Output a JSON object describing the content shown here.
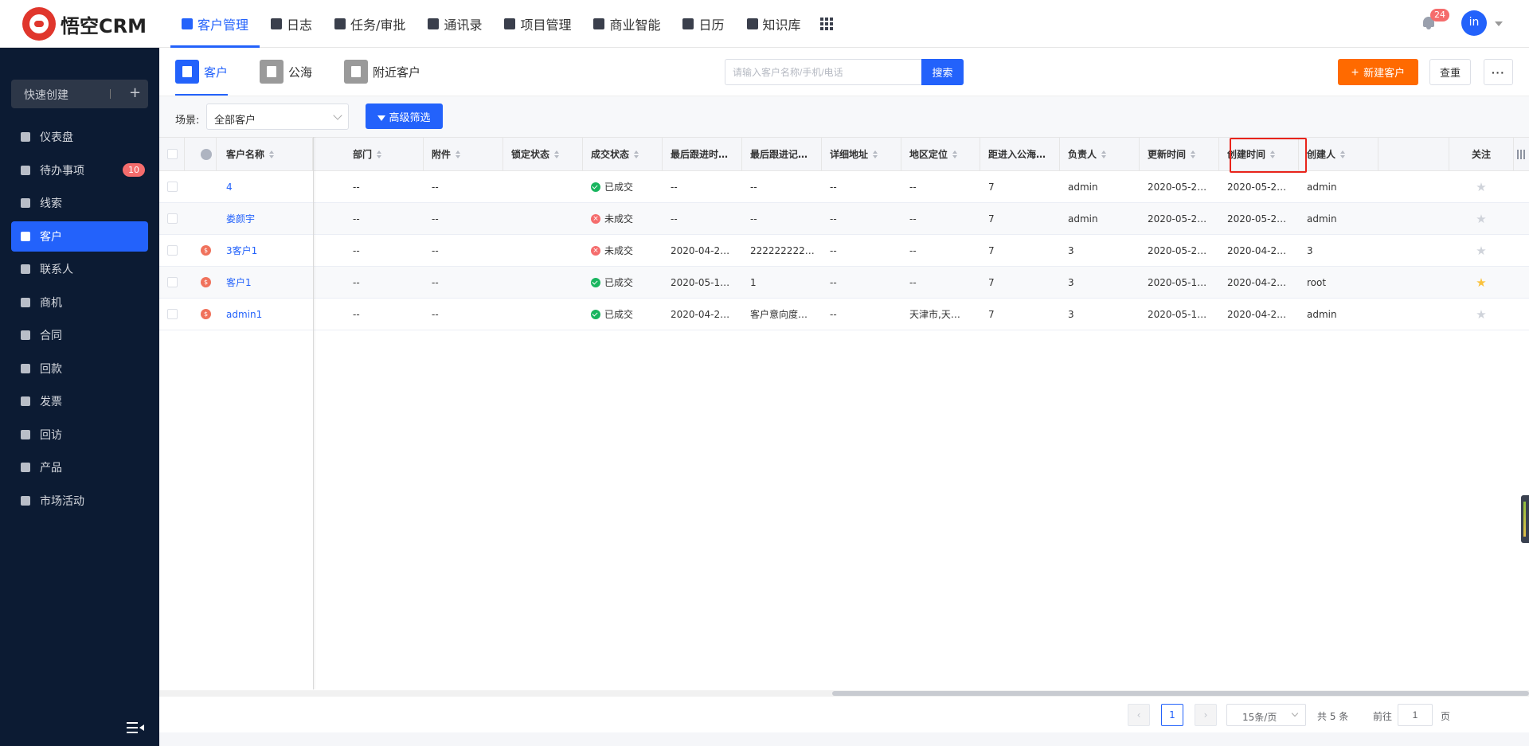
{
  "app": {
    "logo_text": "悟空CRM"
  },
  "topnav": {
    "items": [
      {
        "label": "客户管理",
        "icon": "building-icon",
        "active": true
      },
      {
        "label": "日志",
        "icon": "log-icon"
      },
      {
        "label": "任务/审批",
        "icon": "briefcase-icon"
      },
      {
        "label": "通讯录",
        "icon": "phone-icon"
      },
      {
        "label": "项目管理",
        "icon": "project-icon"
      },
      {
        "label": "商业智能",
        "icon": "shield-icon"
      },
      {
        "label": "日历",
        "icon": "calendar-icon"
      },
      {
        "label": "知识库",
        "icon": "book-icon"
      }
    ],
    "notifications": {
      "count": "24"
    },
    "user": {
      "avatar_text": "in"
    }
  },
  "sidebar": {
    "quick_create": "快速创建",
    "items": [
      {
        "label": "仪表盘",
        "icon": "dashboard-icon"
      },
      {
        "label": "待办事项",
        "icon": "chat-icon",
        "badge": "10"
      },
      {
        "label": "线索",
        "icon": "leads-icon"
      },
      {
        "label": "客户",
        "icon": "building-icon",
        "active": true
      },
      {
        "label": "联系人",
        "icon": "contact-icon"
      },
      {
        "label": "商机",
        "icon": "money-icon"
      },
      {
        "label": "合同",
        "icon": "contract-icon"
      },
      {
        "label": "回款",
        "icon": "moneybag-icon"
      },
      {
        "label": "发票",
        "icon": "invoice-icon"
      },
      {
        "label": "回访",
        "icon": "home-icon"
      },
      {
        "label": "产品",
        "icon": "box-icon"
      },
      {
        "label": "市场活动",
        "icon": "send-icon"
      }
    ]
  },
  "tabs": [
    {
      "label": "客户",
      "icon": "building-icon",
      "active": true
    },
    {
      "label": "公海",
      "icon": "waves-icon"
    },
    {
      "label": "附近客户",
      "icon": "location-icon"
    }
  ],
  "search": {
    "placeholder": "请输入客户名称/手机/电话",
    "button": "搜索"
  },
  "actions": {
    "new_customer": "新建客户",
    "recheck": "查重",
    "more": "···"
  },
  "filter": {
    "scene_label": "场景:",
    "scene_value": "全部客户",
    "advanced": "高级筛选"
  },
  "table": {
    "headers": {
      "name": "客户名称",
      "dept": "部门",
      "attachment": "附件",
      "lock": "锁定状态",
      "deal": "成交状态",
      "last_follow_time": "最后跟进时…",
      "last_follow_record": "最后跟进记…",
      "address": "详细地址",
      "region": "地区定位",
      "days_to_pool": "距进入公海…",
      "owner": "负责人",
      "update_time": "更新时间",
      "create_time": "创建时间",
      "creator": "创建人",
      "follow": "关注"
    },
    "rows": [
      {
        "name": "4",
        "money": false,
        "dept": "--",
        "attachment": "--",
        "lock": "",
        "deal": "已成交",
        "deal_ok": true,
        "last_follow_time": "--",
        "last_follow_record": "--",
        "address": "--",
        "region": "--",
        "days_to_pool": "7",
        "owner": "admin",
        "update_time": "2020-05-2…",
        "create_time": "2020-05-2…",
        "creator": "admin",
        "starred": false
      },
      {
        "name": "娄颜宇",
        "money": false,
        "dept": "--",
        "attachment": "--",
        "lock": "",
        "deal": "未成交",
        "deal_ok": false,
        "last_follow_time": "--",
        "last_follow_record": "--",
        "address": "--",
        "region": "--",
        "days_to_pool": "7",
        "owner": "admin",
        "update_time": "2020-05-2…",
        "create_time": "2020-05-2…",
        "creator": "admin",
        "starred": false
      },
      {
        "name": "3客户1",
        "money": true,
        "dept": "--",
        "attachment": "--",
        "lock": "",
        "deal": "未成交",
        "deal_ok": false,
        "last_follow_time": "2020-04-2…",
        "last_follow_record": "222222222…",
        "address": "--",
        "region": "--",
        "days_to_pool": "7",
        "owner": "3",
        "update_time": "2020-05-2…",
        "create_time": "2020-04-2…",
        "creator": "3",
        "starred": false
      },
      {
        "name": "客户1",
        "money": true,
        "dept": "--",
        "attachment": "--",
        "lock": "",
        "deal": "已成交",
        "deal_ok": true,
        "last_follow_time": "2020-05-1…",
        "last_follow_record": "1",
        "address": "--",
        "region": "--",
        "days_to_pool": "7",
        "owner": "3",
        "update_time": "2020-05-1…",
        "create_time": "2020-04-2…",
        "creator": "root",
        "starred": true
      },
      {
        "name": "admin1",
        "money": true,
        "dept": "--",
        "attachment": "--",
        "lock": "",
        "deal": "已成交",
        "deal_ok": true,
        "last_follow_time": "2020-04-2…",
        "last_follow_record": "客户意向度…",
        "address": "--",
        "region": "天津市,天…",
        "days_to_pool": "7",
        "owner": "3",
        "update_time": "2020-05-1…",
        "create_time": "2020-04-2…",
        "creator": "admin",
        "starred": false
      }
    ]
  },
  "pagination": {
    "current": "1",
    "page_size": "15条/页",
    "total": "共 5 条",
    "goto_label": "前往",
    "goto_value": "1",
    "page_unit": "页",
    "prev": "‹",
    "next": "›"
  },
  "colors": {
    "primary": "#2362fb",
    "accent": "#ff6a00",
    "sidebar_bg": "#0c1b33",
    "highlight": "#e8241b"
  }
}
